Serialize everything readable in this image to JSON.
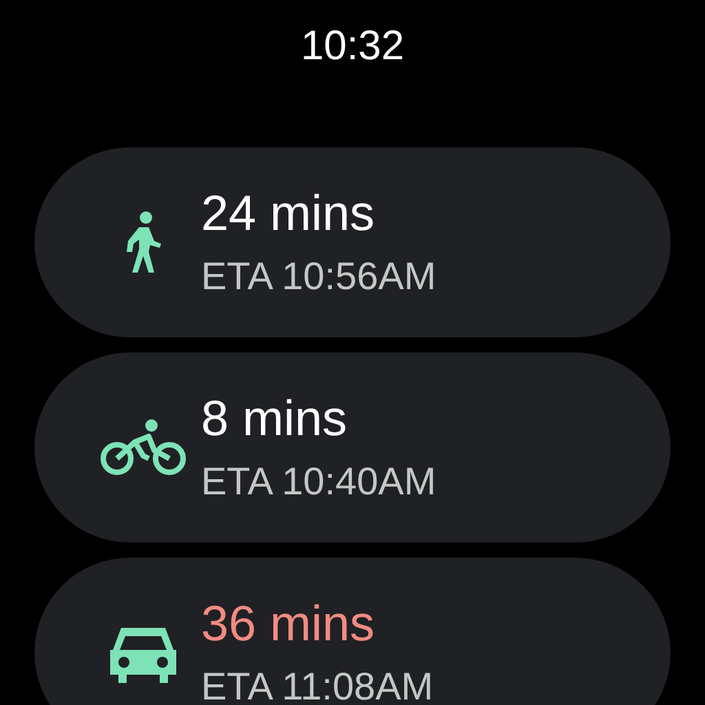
{
  "time": "10:32",
  "routes": [
    {
      "kind": "walk",
      "duration": "24 mins",
      "eta": "ETA 10:56AM",
      "delayed": false
    },
    {
      "kind": "bike",
      "duration": "8 mins",
      "eta": "ETA 10:40AM",
      "delayed": false
    },
    {
      "kind": "car",
      "duration": "36 mins",
      "eta": "ETA 11:08AM",
      "delayed": true
    }
  ]
}
